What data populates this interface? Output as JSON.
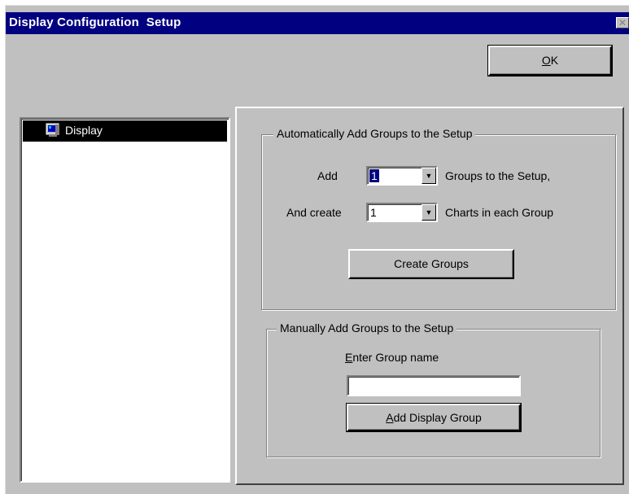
{
  "window": {
    "title": "Display Configuration  Setup",
    "close_glyph": "✕"
  },
  "toolbar": {
    "ok_prefix": "",
    "ok_accel": "O",
    "ok_rest": "K"
  },
  "tree": {
    "items": [
      {
        "label": "Display",
        "icon": "monitor-icon",
        "selected": true
      }
    ]
  },
  "auto_group": {
    "legend": "Automatically Add Groups to the Setup",
    "add_label": "Add",
    "groups_count": "1",
    "groups_suffix": "Groups to the Setup,",
    "create_label": "And create",
    "charts_count": "1",
    "charts_suffix": "Charts in each Group",
    "create_button": "Create Groups"
  },
  "manual_group": {
    "legend": "Manually Add Groups to the Setup",
    "name_label_accel": "E",
    "name_label_rest": "nter Group name",
    "name_value": "",
    "add_button_accel": "A",
    "add_button_rest": "dd Display Group"
  },
  "colors": {
    "titlebar": "#000080",
    "face": "#c0c0c0",
    "selection": "#000000"
  }
}
